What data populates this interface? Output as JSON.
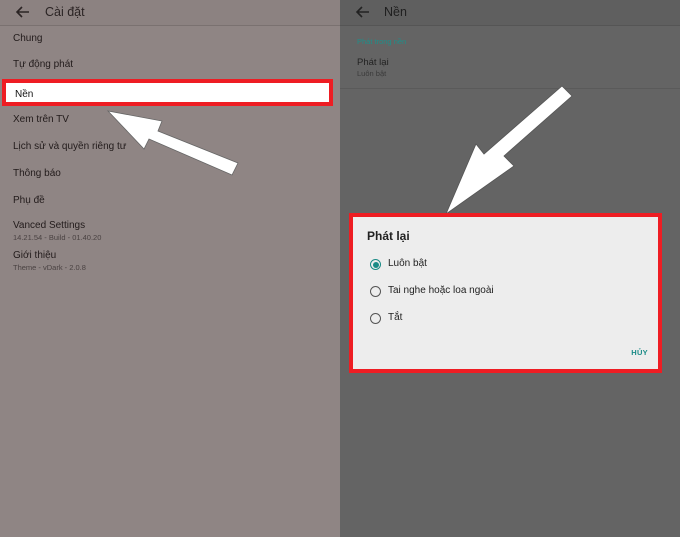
{
  "left_screen": {
    "title": "Cài đặt",
    "items": [
      {
        "label": "Chung"
      },
      {
        "label": "Tự động phát"
      },
      {
        "label": "Nền"
      },
      {
        "label": "Xem trên TV"
      },
      {
        "label": "Lịch sử và quyền riêng tư"
      },
      {
        "label": "Thông báo"
      },
      {
        "label": "Phụ đề"
      },
      {
        "label": "Vanced Settings",
        "sublabel": "14.21.54 - Build - 01.40.20"
      },
      {
        "label": "Giới thiệu",
        "sublabel": "Theme - vDark - 2.0.8"
      }
    ]
  },
  "right_screen": {
    "title": "Nền",
    "section_header": "Phát trong nền",
    "pref_title": "Phát lại",
    "pref_value": "Luôn bật",
    "dialog": {
      "title": "Phát lại",
      "options": [
        {
          "label": "Luôn bật",
          "selected": true
        },
        {
          "label": "Tai nghe hoặc loa ngoài",
          "selected": false
        },
        {
          "label": "Tắt",
          "selected": false
        }
      ],
      "cancel_label": "HỦY"
    }
  },
  "colors": {
    "highlight_red": "#ee1d23",
    "accent_teal": "#1a8b86",
    "left_background": "#8f8584",
    "right_background": "#646464"
  },
  "icons": [
    "back-arrow-icon",
    "pointer-arrow-icon",
    "radio-checked-icon",
    "radio-unchecked-icon"
  ]
}
